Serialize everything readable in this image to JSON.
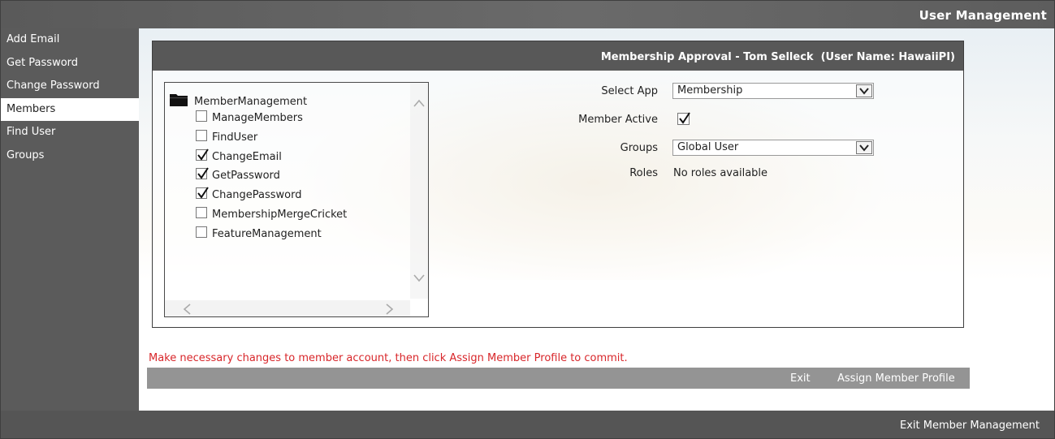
{
  "app": {
    "title": "User Management"
  },
  "sidebar": {
    "items": [
      {
        "label": "Add Email"
      },
      {
        "label": "Get Password"
      },
      {
        "label": "Change Password"
      },
      {
        "label": "Members",
        "active": true
      },
      {
        "label": "Find User"
      },
      {
        "label": "Groups"
      }
    ]
  },
  "panel": {
    "header": "Membership Approval - Tom Selleck  (User Name: HawaiiPI)"
  },
  "tree": {
    "root_label": "MemberManagement",
    "items": [
      {
        "label": "ManageMembers",
        "checked": false
      },
      {
        "label": "FindUser",
        "checked": false
      },
      {
        "label": "ChangeEmail",
        "checked": true
      },
      {
        "label": "GetPassword",
        "checked": true
      },
      {
        "label": "ChangePassword",
        "checked": true
      },
      {
        "label": "MembershipMergeCricket",
        "checked": false
      },
      {
        "label": "FeatureManagement",
        "checked": false
      }
    ]
  },
  "form": {
    "select_app_label": "Select App",
    "select_app_value": "Membership",
    "member_active_label": "Member Active",
    "member_active_checked": true,
    "groups_label": "Groups",
    "groups_value": "Global User",
    "roles_label": "Roles",
    "roles_value": "No roles available"
  },
  "hint": "Make necessary changes to member account, then click Assign Member Profile to commit.",
  "actions": {
    "exit_label": "Exit",
    "assign_label": "Assign Member Profile"
  },
  "footer": {
    "exit_mm_label": "Exit Member Management"
  }
}
